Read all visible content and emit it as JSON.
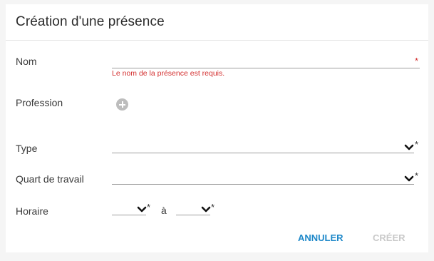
{
  "dialog": {
    "title": "Création d'une présence"
  },
  "form": {
    "name": {
      "label": "Nom",
      "value": "",
      "required_mark": "*",
      "error": "Le nom de la présence est requis."
    },
    "profession": {
      "label": "Profession",
      "add_icon": "add-circle-icon"
    },
    "type": {
      "label": "Type",
      "selected": "",
      "required_mark": "*"
    },
    "shift": {
      "label": "Quart de travail",
      "selected": "",
      "required_mark": "*"
    },
    "schedule": {
      "label": "Horaire",
      "from_selected": "",
      "to_selected": "",
      "separator": "à",
      "from_required_mark": "*",
      "to_required_mark": "*"
    }
  },
  "actions": {
    "cancel_label": "ANNULER",
    "create_label": "CRÉER"
  },
  "colors": {
    "accent": "#1e88c9",
    "error": "#d32f2f",
    "disabled": "#c9c9c9"
  }
}
